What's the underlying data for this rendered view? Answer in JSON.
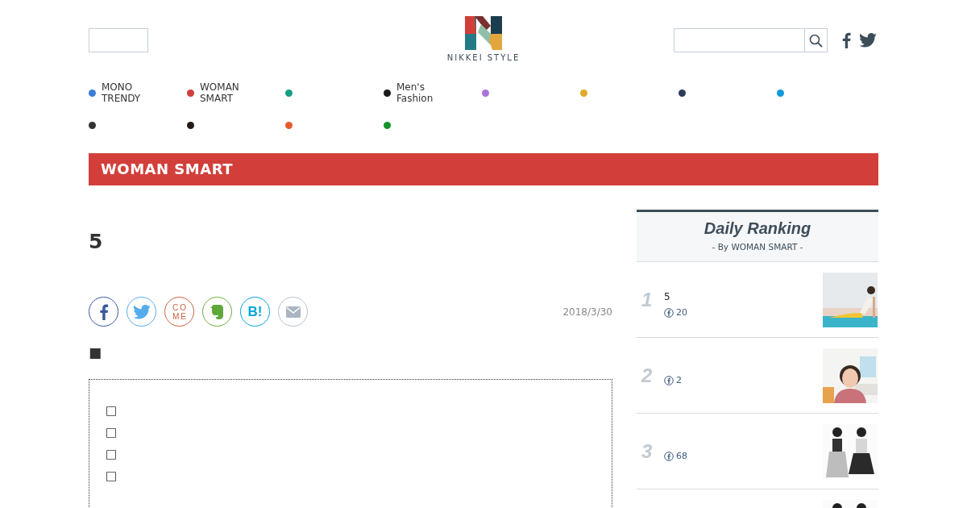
{
  "header": {
    "logo": {
      "wordmark": "NIKKEI STYLE"
    }
  },
  "nav": [
    {
      "label": "MONO TRENDY",
      "color": "#3b7dd8"
    },
    {
      "label": "WOMAN SMART",
      "color": "#d23f3a"
    },
    {
      "color": "#139f86"
    },
    {
      "label": "Men's Fashion",
      "color": "#1a1a1a"
    },
    {
      "color": "#a972d8"
    },
    {
      "color": "#e0a92a"
    },
    {
      "color": "#2e3b5a"
    },
    {
      "color": "#1399dc"
    },
    {
      "color": "#333333"
    },
    {
      "color": "#231a17"
    },
    {
      "color": "#e55a2f"
    },
    {
      "color": "#12942b"
    }
  ],
  "section_bar": {
    "title": "WOMAN SMART"
  },
  "article": {
    "title": "5",
    "date": "2018/3/30",
    "share": [
      {
        "kind": "facebook"
      },
      {
        "kind": "twitter"
      },
      {
        "kind": "come",
        "label": "COME"
      },
      {
        "kind": "evernote"
      },
      {
        "kind": "hatena",
        "label": "B!"
      },
      {
        "kind": "mail"
      }
    ],
    "lead": "■",
    "toc": [
      "□",
      "□",
      "□",
      "□"
    ]
  },
  "ranking": {
    "title": "Daily Ranking",
    "subtitle": "- By WOMAN SMART -",
    "items": [
      {
        "kind": "article",
        "rank": "1",
        "title": "5",
        "shares": "20"
      },
      {
        "kind": "article",
        "rank": "2",
        "shares": "2"
      },
      {
        "kind": "article",
        "rank": "3",
        "shares": "68"
      },
      {
        "kind": "picture"
      }
    ]
  }
}
